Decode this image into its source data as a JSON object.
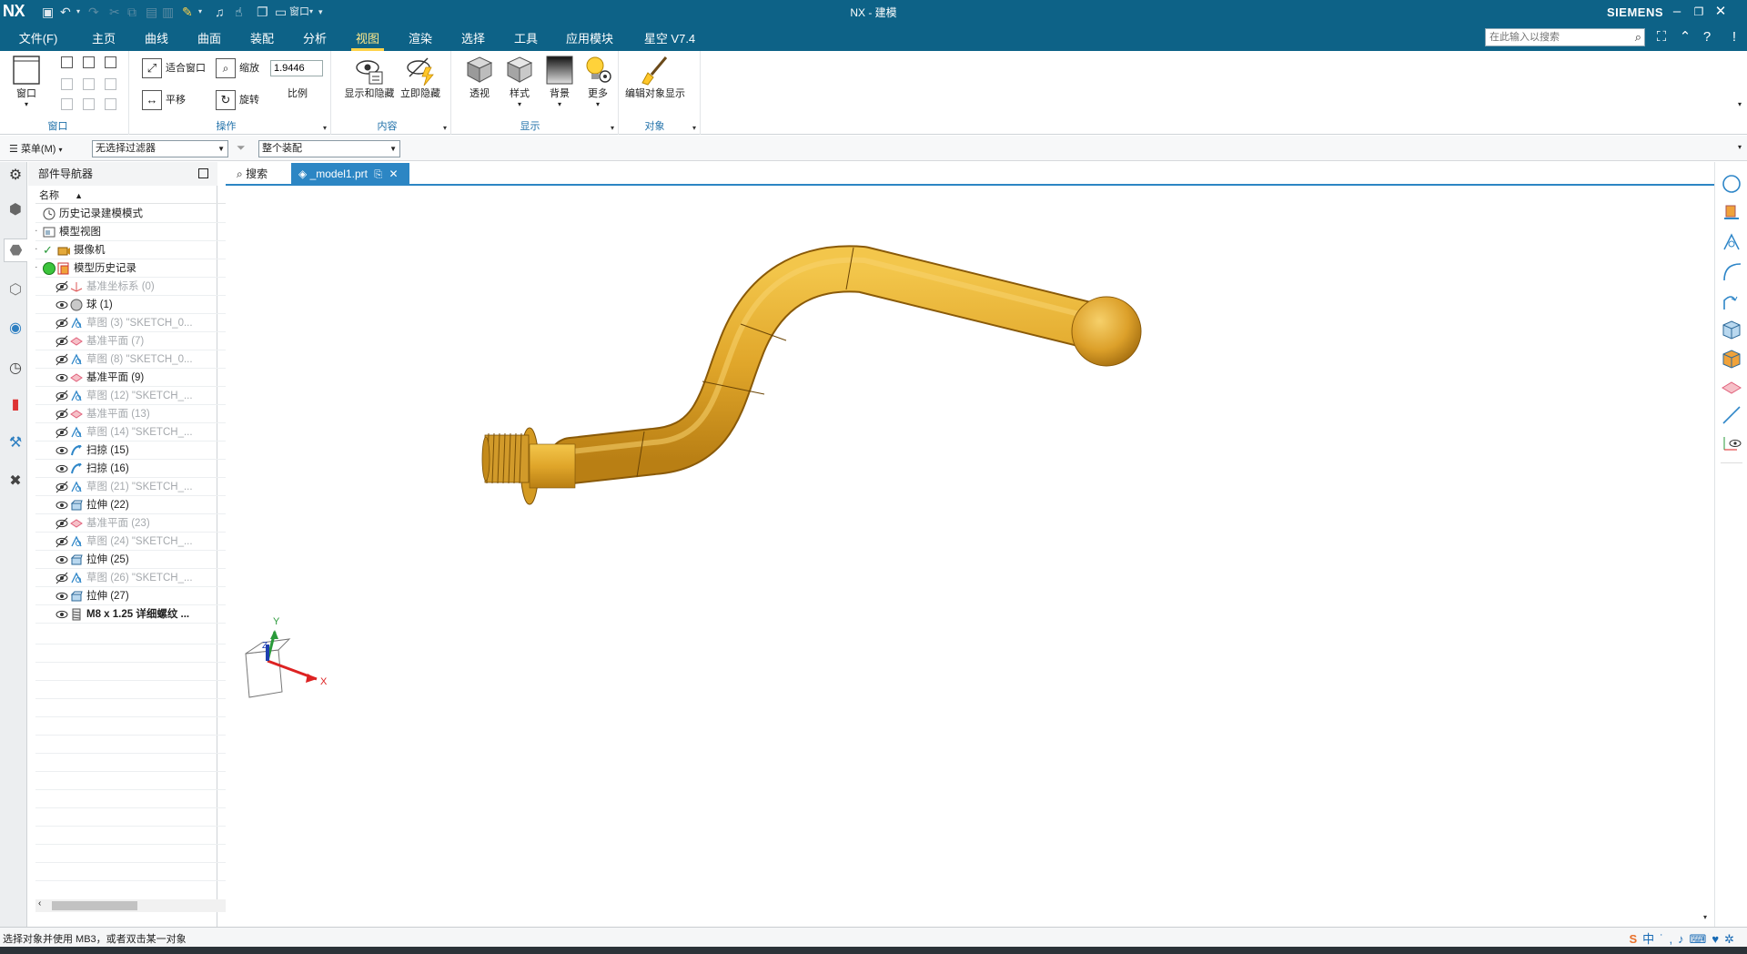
{
  "app": {
    "logo": "NX",
    "window_title": "NX - 建模",
    "brand": "SIEMENS",
    "window_label": "窗口"
  },
  "tabs": [
    "文件(F)",
    "主页",
    "曲线",
    "曲面",
    "装配",
    "分析",
    "视图",
    "渲染",
    "选择",
    "工具",
    "应用模块",
    "星空 V7.4"
  ],
  "active_tab": "视图",
  "search": {
    "placeholder": "在此输入以搜索"
  },
  "ribbon": {
    "window_group": {
      "label": "窗口",
      "button": "窗口"
    },
    "operation_group": {
      "label": "操作",
      "fit": "适合窗口",
      "zoom": "缩放",
      "zoom_value": "1.9446",
      "scale_label": "比例",
      "pan": "平移",
      "rotate": "旋转"
    },
    "content_group": {
      "label": "内容",
      "show_hide": "显示和隐藏",
      "immediate_hide": "立即隐藏"
    },
    "display_group": {
      "label": "显示",
      "perspective": "透视",
      "style": "样式",
      "background": "背景",
      "more": "更多"
    },
    "object_group": {
      "label": "对象",
      "edit_display": "编辑对象显示"
    }
  },
  "filterbar": {
    "menu": "菜单(M)",
    "selection_filter": "无选择过滤器",
    "scope": "整个装配"
  },
  "navigator": {
    "title": "部件导航器",
    "column_name": "名称",
    "items": [
      {
        "label": "历史记录建模模式",
        "level": 0,
        "expand": "",
        "dim": false,
        "eye": false,
        "icon": "clock"
      },
      {
        "label": "模型视图",
        "level": 0,
        "expand": "+",
        "dim": false,
        "eye": false,
        "icon": "views"
      },
      {
        "label": "摄像机",
        "level": 0,
        "expand": "+",
        "dim": false,
        "eye": false,
        "icon": "camera",
        "check": true
      },
      {
        "label": "模型历史记录",
        "level": 0,
        "expand": "−",
        "dim": false,
        "eye": false,
        "icon": "history",
        "green": true
      },
      {
        "label": "基准坐标系 (0)",
        "level": 1,
        "dim": true,
        "eye": true,
        "icon": "csys"
      },
      {
        "label": "球 (1)",
        "level": 1,
        "dim": false,
        "eye": true,
        "icon": "sphere"
      },
      {
        "label": "草图 (3) \"SKETCH_0...",
        "level": 1,
        "dim": true,
        "eye": true,
        "icon": "sketch"
      },
      {
        "label": "基准平面 (7)",
        "level": 1,
        "dim": true,
        "eye": true,
        "icon": "plane"
      },
      {
        "label": "草图 (8) \"SKETCH_0...",
        "level": 1,
        "dim": true,
        "eye": true,
        "icon": "sketch"
      },
      {
        "label": "基准平面 (9)",
        "level": 1,
        "dim": false,
        "eye": true,
        "icon": "plane"
      },
      {
        "label": "草图 (12) \"SKETCH_...",
        "level": 1,
        "dim": true,
        "eye": true,
        "icon": "sketch"
      },
      {
        "label": "基准平面 (13)",
        "level": 1,
        "dim": true,
        "eye": true,
        "icon": "plane"
      },
      {
        "label": "草图 (14) \"SKETCH_...",
        "level": 1,
        "dim": true,
        "eye": true,
        "icon": "sketch"
      },
      {
        "label": "扫掠 (15)",
        "level": 1,
        "dim": false,
        "eye": true,
        "icon": "sweep"
      },
      {
        "label": "扫掠 (16)",
        "level": 1,
        "dim": false,
        "eye": true,
        "icon": "sweep"
      },
      {
        "label": "草图 (21) \"SKETCH_...",
        "level": 1,
        "dim": true,
        "eye": true,
        "icon": "sketch"
      },
      {
        "label": "拉伸 (22)",
        "level": 1,
        "dim": false,
        "eye": true,
        "icon": "extrude"
      },
      {
        "label": "基准平面 (23)",
        "level": 1,
        "dim": true,
        "eye": true,
        "icon": "plane"
      },
      {
        "label": "草图 (24) \"SKETCH_...",
        "level": 1,
        "dim": true,
        "eye": true,
        "icon": "sketch"
      },
      {
        "label": "拉伸 (25)",
        "level": 1,
        "dim": false,
        "eye": true,
        "icon": "extrude"
      },
      {
        "label": "草图 (26) \"SKETCH_...",
        "level": 1,
        "dim": true,
        "eye": true,
        "icon": "sketch"
      },
      {
        "label": "拉伸 (27)",
        "level": 1,
        "dim": false,
        "eye": true,
        "icon": "extrude"
      },
      {
        "label": "M8 x 1.25 详细螺纹 ...",
        "level": 1,
        "dim": false,
        "eye": true,
        "icon": "thread",
        "bold": true
      }
    ]
  },
  "doc_tabs": {
    "search": "搜索",
    "model": "_model1.prt"
  },
  "triad": {
    "x": "X",
    "y": "Y",
    "z": "Z"
  },
  "status": {
    "message": "选择对象并使用 MB3，或者双击某一对象"
  },
  "colors": {
    "titlebar": "#0d6287",
    "accent_tab": "#ffd34a",
    "active_doc_tab": "#2c86c4",
    "model": "#e0a62a"
  }
}
